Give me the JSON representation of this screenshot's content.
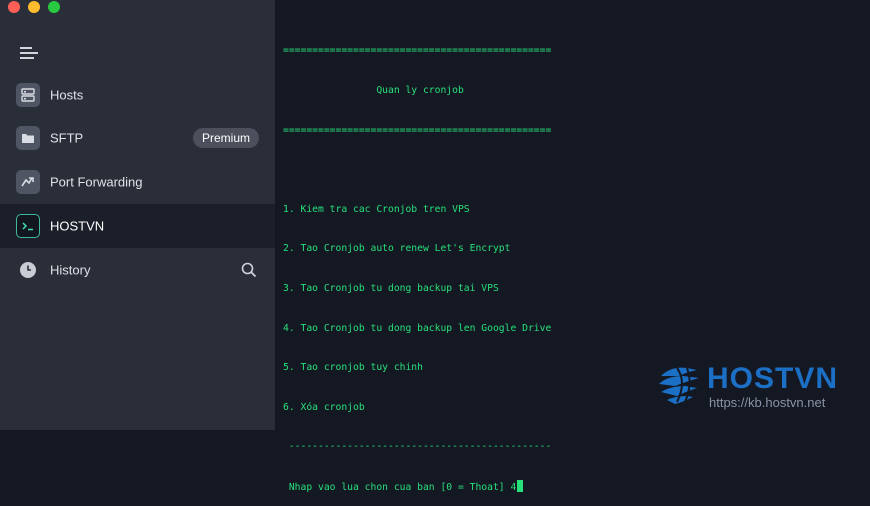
{
  "window": {
    "controls": [
      "close",
      "minimize",
      "maximize"
    ]
  },
  "sidebar": {
    "menu_icon": "hamburger-menu-icon",
    "items": [
      {
        "label": "Hosts",
        "icon": "hosts-grid-icon"
      },
      {
        "label": "SFTP",
        "icon": "folder-icon",
        "badge": "Premium"
      },
      {
        "label": "Port Forwarding",
        "icon": "port-forward-icon"
      },
      {
        "label": "HOSTVN",
        "icon": "terminal-prompt-icon",
        "active": true
      },
      {
        "label": "History",
        "icon": "clock-icon",
        "action_icon": "search-icon"
      }
    ]
  },
  "terminal": {
    "lines": [
      "==============================================",
      "                Quan ly cronjob",
      "==============================================",
      "",
      "1. Kiem tra cac Cronjob tren VPS",
      "2. Tao Cronjob auto renew Let's Encrypt",
      "3. Tao Cronjob tu dong backup tai VPS",
      "4. Tao Cronjob tu dong backup len Google Drive",
      "5. Tao cronjob tuy chinh",
      "6. Xóa cronjob",
      " ---------------------------------------------",
      " Nhap vao lua chon cua ban [0 = Thoat] 4"
    ]
  },
  "watermark": {
    "brand": "HOSTVN",
    "url": "https://kb.hostvn.net",
    "color": "#1b6fc4"
  }
}
